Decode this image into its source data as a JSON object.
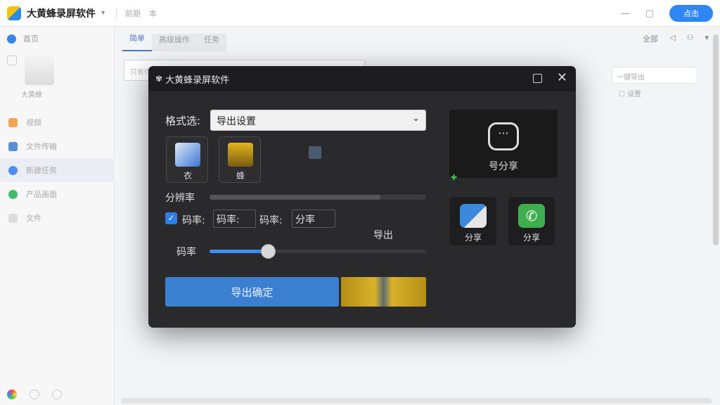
{
  "app": {
    "name": "大黄蜂录屏软件",
    "toolbar_links": [
      "前期",
      "本"
    ],
    "action_button": "点击"
  },
  "sidebar": {
    "header_label": "首页",
    "thumb_label": "大黄蜂",
    "items": [
      {
        "label": "视频",
        "color": "#f2a455"
      },
      {
        "label": "文件传输",
        "color": "#5a8fd6"
      },
      {
        "label": "新建任务",
        "color": "#4e8ef0"
      },
      {
        "label": "产品画面",
        "color": "#3fbf6b"
      },
      {
        "label": "文件",
        "color": "#cccccc"
      }
    ]
  },
  "main": {
    "tabs": [
      "简单",
      "高级操作",
      "任务"
    ],
    "right_actions": [
      "全部"
    ],
    "search_placeholder": "只有你的视频…",
    "right_input": "一键导出",
    "right_check": "设置"
  },
  "dialog": {
    "title": "大黄蜂录屏软件",
    "format_label": "格式选:",
    "format_value": "导出设置",
    "tiles": [
      {
        "label": "衣",
        "icon": "document-chart-icon",
        "color": "#3b78d6"
      },
      {
        "label": "蜂",
        "icon": "robot-icon",
        "color": "#e2b51e"
      }
    ],
    "resolution_label": "分辨率",
    "resolution_progress": 0.79,
    "bitrate_checked": true,
    "bitrate_label1": "码率:",
    "bitrate_box1": "码率:",
    "bitrate_label2": "码率:",
    "bitrate_box2": "分率",
    "export_text": "导出",
    "rate_label": "码率",
    "rate_value": 0.27,
    "export_button": "导出确定",
    "share_big_label": "号分享",
    "share_tiles": [
      {
        "label": "分享",
        "icon": "app-share-icon",
        "color": "#3b8ad9"
      },
      {
        "label": "分享",
        "icon": "phone-call-icon",
        "color": "#3fae4f"
      }
    ]
  }
}
